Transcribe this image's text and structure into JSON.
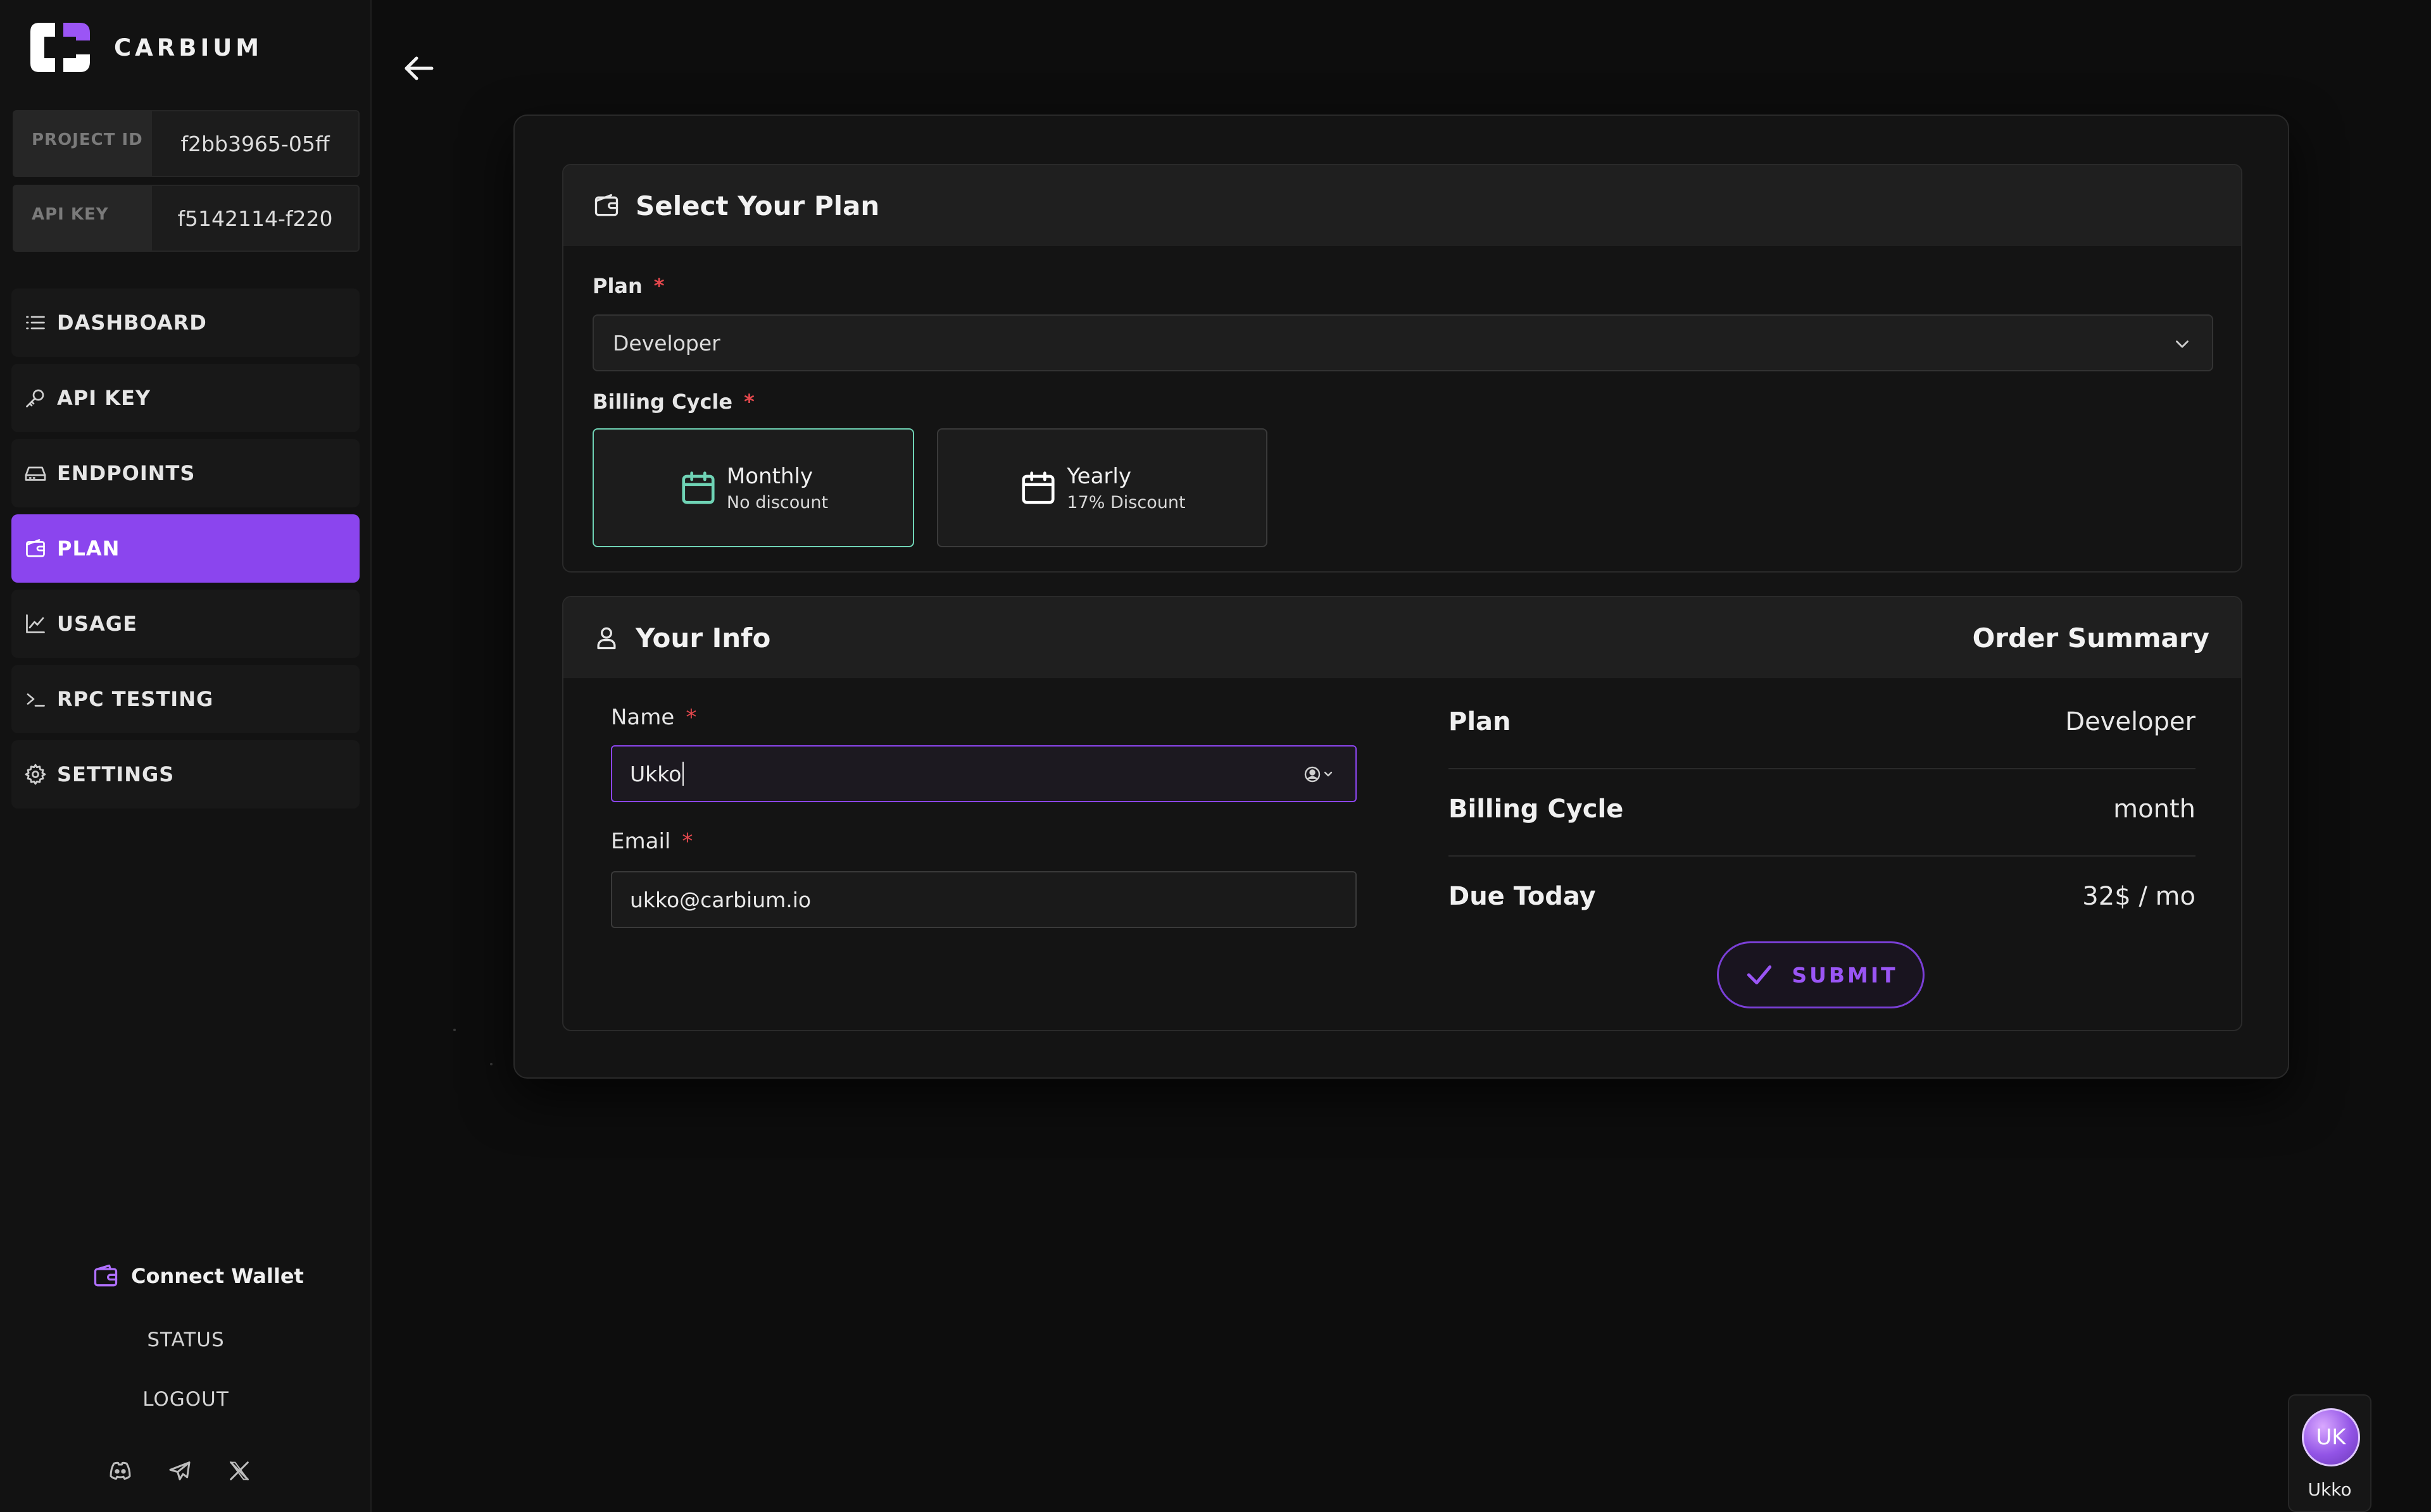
{
  "brand": {
    "name": "CARBIUM"
  },
  "credentials": {
    "project_id_label": "PROJECT ID",
    "project_id_value": "f2bb3965-05ff",
    "api_key_label": "API KEY",
    "api_key_value": "f5142114-f220"
  },
  "nav": {
    "items": [
      {
        "label": "DASHBOARD",
        "icon": "list-icon"
      },
      {
        "label": "API KEY",
        "icon": "key-icon"
      },
      {
        "label": "ENDPOINTS",
        "icon": "drive-icon"
      },
      {
        "label": "PLAN",
        "icon": "wallet-icon",
        "active": true
      },
      {
        "label": "USAGE",
        "icon": "chart-line-icon"
      },
      {
        "label": "RPC TESTING",
        "icon": "terminal-icon"
      },
      {
        "label": "SETTINGS",
        "icon": "gear-icon"
      }
    ]
  },
  "sidebar_footer": {
    "connect_wallet": "Connect Wallet",
    "status": "STATUS",
    "logout": "LOGOUT",
    "socials": [
      "discord-icon",
      "telegram-icon",
      "x-icon"
    ]
  },
  "plan_section": {
    "title": "Select Your Plan",
    "plan_label": "Plan",
    "plan_value": "Developer",
    "billing_label": "Billing Cycle",
    "cycles": [
      {
        "name": "Monthly",
        "sub": "No discount",
        "selected": true
      },
      {
        "name": "Yearly",
        "sub": "17% Discount",
        "selected": false
      }
    ]
  },
  "info_section": {
    "title": "Your Info",
    "summary_title": "Order Summary",
    "name_label": "Name",
    "name_value": "Ukko",
    "email_label": "Email",
    "email_value": "ukko@carbium.io"
  },
  "summary": {
    "rows": [
      {
        "key": "Plan",
        "value": "Developer"
      },
      {
        "key": "Billing Cycle",
        "value": "month"
      },
      {
        "key": "Due Today",
        "value": "32$ / mo"
      }
    ],
    "submit_label": "SUBMIT"
  },
  "user": {
    "initials": "UK",
    "name": "Ukko"
  },
  "colors": {
    "accent": "#8b45ee",
    "selected_border": "#6fd3b5",
    "required": "#e5484d"
  }
}
